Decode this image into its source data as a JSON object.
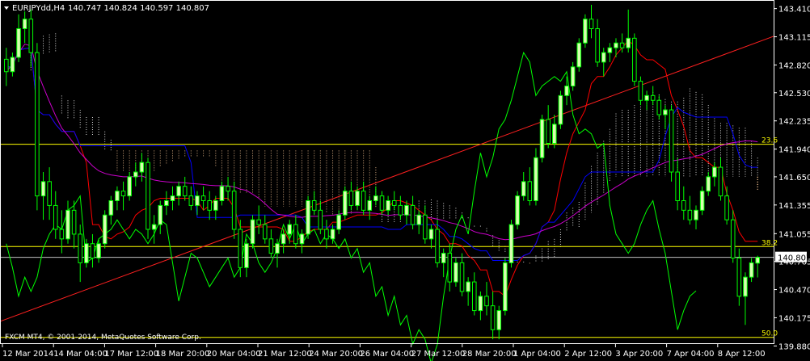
{
  "header": {
    "symbol": "EURJPYdd,H4",
    "ohlc": "140.747 140.824 140.597 140.807"
  },
  "footer": {
    "copyright": "FXCM MT4, © 2001-2014, MetaQuotes Software Corp."
  },
  "current_price_label": "140.807",
  "fib_labels": [
    "23.6",
    "38.2",
    "50.0"
  ],
  "colors": {
    "bull_candle": "#d8ffb0",
    "bear_candle": "#000000",
    "wick": "#00ff00",
    "red_ma": "#ff0000",
    "blue_line": "#0000ff",
    "magenta_line": "#cc00cc",
    "green_chikou": "#00ff00",
    "fib": "#ffff00",
    "cloud": "#ffffff",
    "cloud_alt": "#ffcc99",
    "trendline": "#ff2020",
    "grid": "#ffffff"
  },
  "chart_data": {
    "type": "candlestick",
    "symbol": "EURJPYdd",
    "timeframe": "H4",
    "ylim": [
      139.9,
      143.5
    ],
    "yticks": [
      "143.410",
      "143.115",
      "142.820",
      "142.530",
      "142.235",
      "141.940",
      "141.650",
      "141.355",
      "141.055",
      "140.765",
      "140.470",
      "140.175",
      "139.880"
    ],
    "xticks": [
      "12 Mar 2014",
      "14 Mar 04:00",
      "17 Mar 12:00",
      "18 Mar 20:00",
      "20 Mar 04:00",
      "21 Mar 12:00",
      "24 Mar 20:00",
      "26 Mar 04:00",
      "27 Mar 12:00",
      "28 Mar 20:00",
      "1 Apr 04:00",
      "2 Apr 12:00",
      "3 Apr 20:00",
      "7 Apr 04:00",
      "8 Apr 12:00"
    ],
    "current_price": 140.807,
    "fibonacci": [
      {
        "level": "23.6",
        "price": 141.99
      },
      {
        "level": "38.2",
        "price": 140.92
      },
      {
        "level": "50.0",
        "price": 139.97
      }
    ],
    "trendline": {
      "start": [
        0,
        140.13
      ],
      "end": [
        157,
        143.12
      ]
    },
    "candles": [
      [
        142.88,
        143.0,
        142.6,
        142.75
      ],
      [
        142.75,
        142.95,
        142.7,
        142.9
      ],
      [
        142.9,
        143.35,
        142.85,
        143.2
      ],
      [
        143.2,
        143.38,
        143.05,
        143.3
      ],
      [
        143.3,
        143.4,
        142.8,
        142.95
      ],
      [
        142.95,
        143.05,
        141.3,
        141.45
      ],
      [
        141.45,
        141.7,
        141.2,
        141.6
      ],
      [
        141.6,
        141.75,
        141.2,
        141.35
      ],
      [
        141.35,
        141.5,
        141.0,
        141.1
      ],
      [
        141.1,
        141.3,
        140.85,
        141.0
      ],
      [
        141.0,
        141.4,
        140.95,
        141.3
      ],
      [
        141.3,
        141.4,
        140.9,
        141.05
      ],
      [
        141.05,
        141.15,
        140.55,
        140.75
      ],
      [
        140.75,
        141.0,
        140.7,
        140.95
      ],
      [
        140.95,
        141.05,
        140.7,
        140.8
      ],
      [
        140.8,
        141.0,
        140.75,
        140.95
      ],
      [
        140.95,
        141.3,
        140.9,
        141.25
      ],
      [
        141.25,
        141.45,
        141.15,
        141.4
      ],
      [
        141.4,
        141.55,
        141.3,
        141.5
      ],
      [
        141.5,
        141.6,
        141.3,
        141.45
      ],
      [
        141.45,
        141.7,
        141.4,
        141.65
      ],
      [
        141.65,
        141.8,
        141.55,
        141.7
      ],
      [
        141.7,
        141.9,
        141.6,
        141.8
      ],
      [
        141.8,
        141.85,
        141.0,
        141.1
      ],
      [
        141.1,
        141.25,
        140.95,
        141.15
      ],
      [
        141.15,
        141.4,
        141.05,
        141.35
      ],
      [
        141.35,
        141.5,
        141.25,
        141.4
      ],
      [
        141.4,
        141.55,
        141.3,
        141.45
      ],
      [
        141.45,
        141.6,
        141.35,
        141.55
      ],
      [
        141.55,
        141.65,
        141.4,
        141.45
      ],
      [
        141.45,
        141.55,
        141.3,
        141.35
      ],
      [
        141.35,
        141.5,
        141.25,
        141.45
      ],
      [
        141.45,
        141.55,
        141.3,
        141.4
      ],
      [
        141.4,
        141.5,
        141.2,
        141.3
      ],
      [
        141.3,
        141.45,
        141.2,
        141.4
      ],
      [
        141.4,
        141.6,
        141.35,
        141.55
      ],
      [
        141.55,
        141.65,
        141.4,
        141.5
      ],
      [
        141.5,
        141.6,
        141.0,
        141.1
      ],
      [
        141.1,
        141.2,
        140.6,
        140.7
      ],
      [
        140.7,
        141.0,
        140.6,
        140.95
      ],
      [
        140.95,
        141.25,
        140.9,
        141.2
      ],
      [
        141.2,
        141.35,
        141.05,
        141.15
      ],
      [
        141.15,
        141.25,
        140.95,
        141.0
      ],
      [
        141.0,
        141.1,
        140.8,
        140.85
      ],
      [
        140.85,
        141.0,
        140.7,
        140.95
      ],
      [
        140.95,
        141.1,
        140.85,
        141.05
      ],
      [
        141.05,
        141.2,
        140.95,
        141.15
      ],
      [
        141.15,
        141.25,
        140.9,
        140.95
      ],
      [
        140.95,
        141.1,
        140.85,
        141.05
      ],
      [
        141.05,
        141.45,
        141.0,
        141.4
      ],
      [
        141.4,
        141.5,
        141.25,
        141.3
      ],
      [
        141.3,
        141.4,
        141.05,
        141.1
      ],
      [
        141.1,
        141.2,
        140.9,
        141.0
      ],
      [
        141.0,
        141.15,
        140.95,
        141.1
      ],
      [
        141.1,
        141.3,
        141.05,
        141.25
      ],
      [
        141.25,
        141.55,
        141.2,
        141.5
      ],
      [
        141.5,
        141.6,
        141.3,
        141.35
      ],
      [
        141.35,
        141.55,
        141.3,
        141.5
      ],
      [
        141.5,
        141.6,
        141.25,
        141.3
      ],
      [
        141.3,
        141.45,
        141.2,
        141.4
      ],
      [
        141.4,
        141.55,
        141.35,
        141.45
      ],
      [
        141.45,
        141.5,
        141.25,
        141.3
      ],
      [
        141.3,
        141.45,
        141.25,
        141.4
      ],
      [
        141.4,
        141.5,
        141.3,
        141.35
      ],
      [
        141.35,
        141.45,
        141.2,
        141.25
      ],
      [
        141.25,
        141.4,
        141.15,
        141.35
      ],
      [
        141.35,
        141.45,
        141.1,
        141.15
      ],
      [
        141.15,
        141.3,
        141.05,
        141.25
      ],
      [
        141.25,
        141.35,
        140.95,
        141.0
      ],
      [
        141.0,
        141.15,
        140.9,
        141.1
      ],
      [
        141.1,
        141.2,
        140.7,
        140.75
      ],
      [
        140.75,
        140.9,
        140.6,
        140.85
      ],
      [
        140.85,
        140.95,
        140.45,
        140.55
      ],
      [
        140.55,
        140.8,
        140.5,
        140.75
      ],
      [
        140.75,
        140.85,
        140.4,
        140.45
      ],
      [
        140.45,
        140.6,
        140.3,
        140.55
      ],
      [
        140.55,
        140.65,
        140.2,
        140.25
      ],
      [
        140.25,
        140.45,
        140.15,
        140.4
      ],
      [
        140.4,
        140.55,
        140.2,
        140.3
      ],
      [
        140.3,
        140.45,
        139.95,
        140.05
      ],
      [
        140.05,
        140.3,
        139.95,
        140.25
      ],
      [
        140.25,
        140.8,
        140.2,
        140.75
      ],
      [
        140.75,
        141.2,
        140.7,
        141.15
      ],
      [
        141.15,
        141.5,
        141.1,
        141.45
      ],
      [
        141.45,
        141.7,
        141.4,
        141.6
      ],
      [
        141.6,
        141.75,
        141.35,
        141.4
      ],
      [
        141.4,
        141.95,
        141.35,
        141.85
      ],
      [
        141.85,
        142.3,
        141.8,
        142.25
      ],
      [
        142.25,
        142.4,
        141.95,
        142.0
      ],
      [
        142.0,
        142.3,
        141.95,
        142.2
      ],
      [
        142.2,
        142.55,
        142.15,
        142.5
      ],
      [
        142.5,
        142.7,
        142.4,
        142.6
      ],
      [
        142.6,
        142.85,
        142.55,
        142.8
      ],
      [
        142.8,
        143.1,
        142.75,
        143.05
      ],
      [
        143.05,
        143.35,
        143.0,
        143.3
      ],
      [
        143.3,
        143.45,
        143.1,
        143.2
      ],
      [
        143.2,
        143.3,
        142.8,
        142.85
      ],
      [
        142.85,
        143.0,
        142.7,
        142.95
      ],
      [
        142.95,
        143.05,
        142.85,
        143.0
      ],
      [
        143.0,
        143.1,
        142.9,
        143.05
      ],
      [
        143.05,
        143.15,
        142.95,
        143.0
      ],
      [
        143.0,
        143.4,
        142.95,
        143.1
      ],
      [
        143.1,
        143.15,
        142.6,
        142.65
      ],
      [
        142.65,
        142.7,
        142.4,
        142.45
      ],
      [
        142.45,
        142.55,
        142.35,
        142.5
      ],
      [
        142.5,
        142.6,
        142.4,
        142.45
      ],
      [
        142.45,
        142.5,
        142.25,
        142.3
      ],
      [
        142.3,
        142.4,
        142.15,
        142.35
      ],
      [
        142.35,
        142.4,
        141.6,
        141.7
      ],
      [
        141.7,
        141.85,
        141.3,
        141.4
      ],
      [
        141.4,
        141.55,
        141.2,
        141.3
      ],
      [
        141.3,
        141.45,
        141.15,
        141.2
      ],
      [
        141.2,
        141.35,
        141.1,
        141.3
      ],
      [
        141.3,
        141.55,
        141.25,
        141.5
      ],
      [
        141.5,
        141.7,
        141.45,
        141.65
      ],
      [
        141.65,
        141.8,
        141.55,
        141.75
      ],
      [
        141.75,
        141.85,
        141.4,
        141.45
      ],
      [
        141.45,
        141.55,
        141.15,
        141.2
      ],
      [
        141.2,
        141.3,
        140.75,
        140.8
      ],
      [
        140.8,
        140.9,
        140.3,
        140.4
      ],
      [
        140.4,
        140.65,
        140.1,
        140.6
      ],
      [
        140.6,
        140.8,
        140.55,
        140.75
      ],
      [
        140.747,
        140.824,
        140.597,
        140.807
      ]
    ]
  }
}
